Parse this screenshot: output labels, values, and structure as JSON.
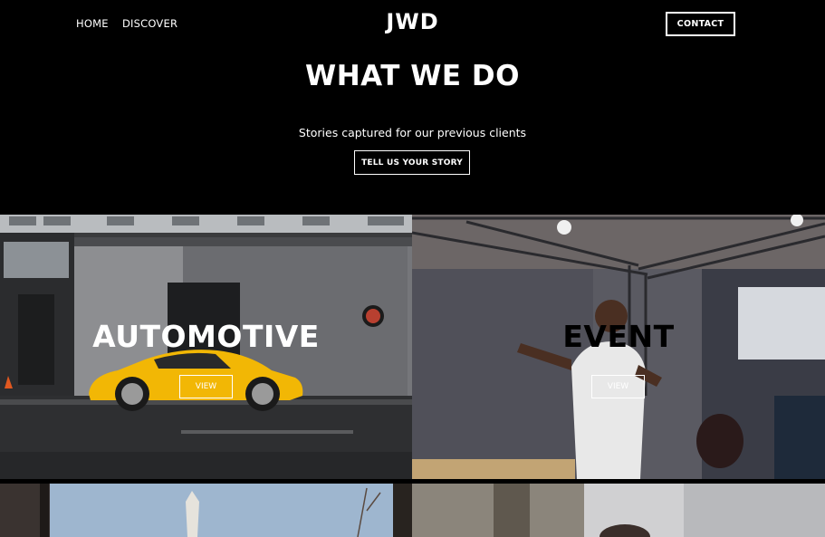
{
  "nav": {
    "home_label": "HOME",
    "discover_label": "DISCOVER",
    "logo": "JWD",
    "contact_label": "CONTACT"
  },
  "hero": {
    "title": "WHAT WE DO",
    "subtitle": "Stories captured for our previous clients",
    "cta_label": "TELL US YOUR STORY"
  },
  "tiles": [
    {
      "label": "AUTOMOTIVE",
      "button": "VIEW"
    },
    {
      "label": "EVENT",
      "button": "VIEW"
    }
  ],
  "colors": {
    "background": "#000000",
    "text": "#ffffff",
    "car_yellow": "#f2b705"
  }
}
